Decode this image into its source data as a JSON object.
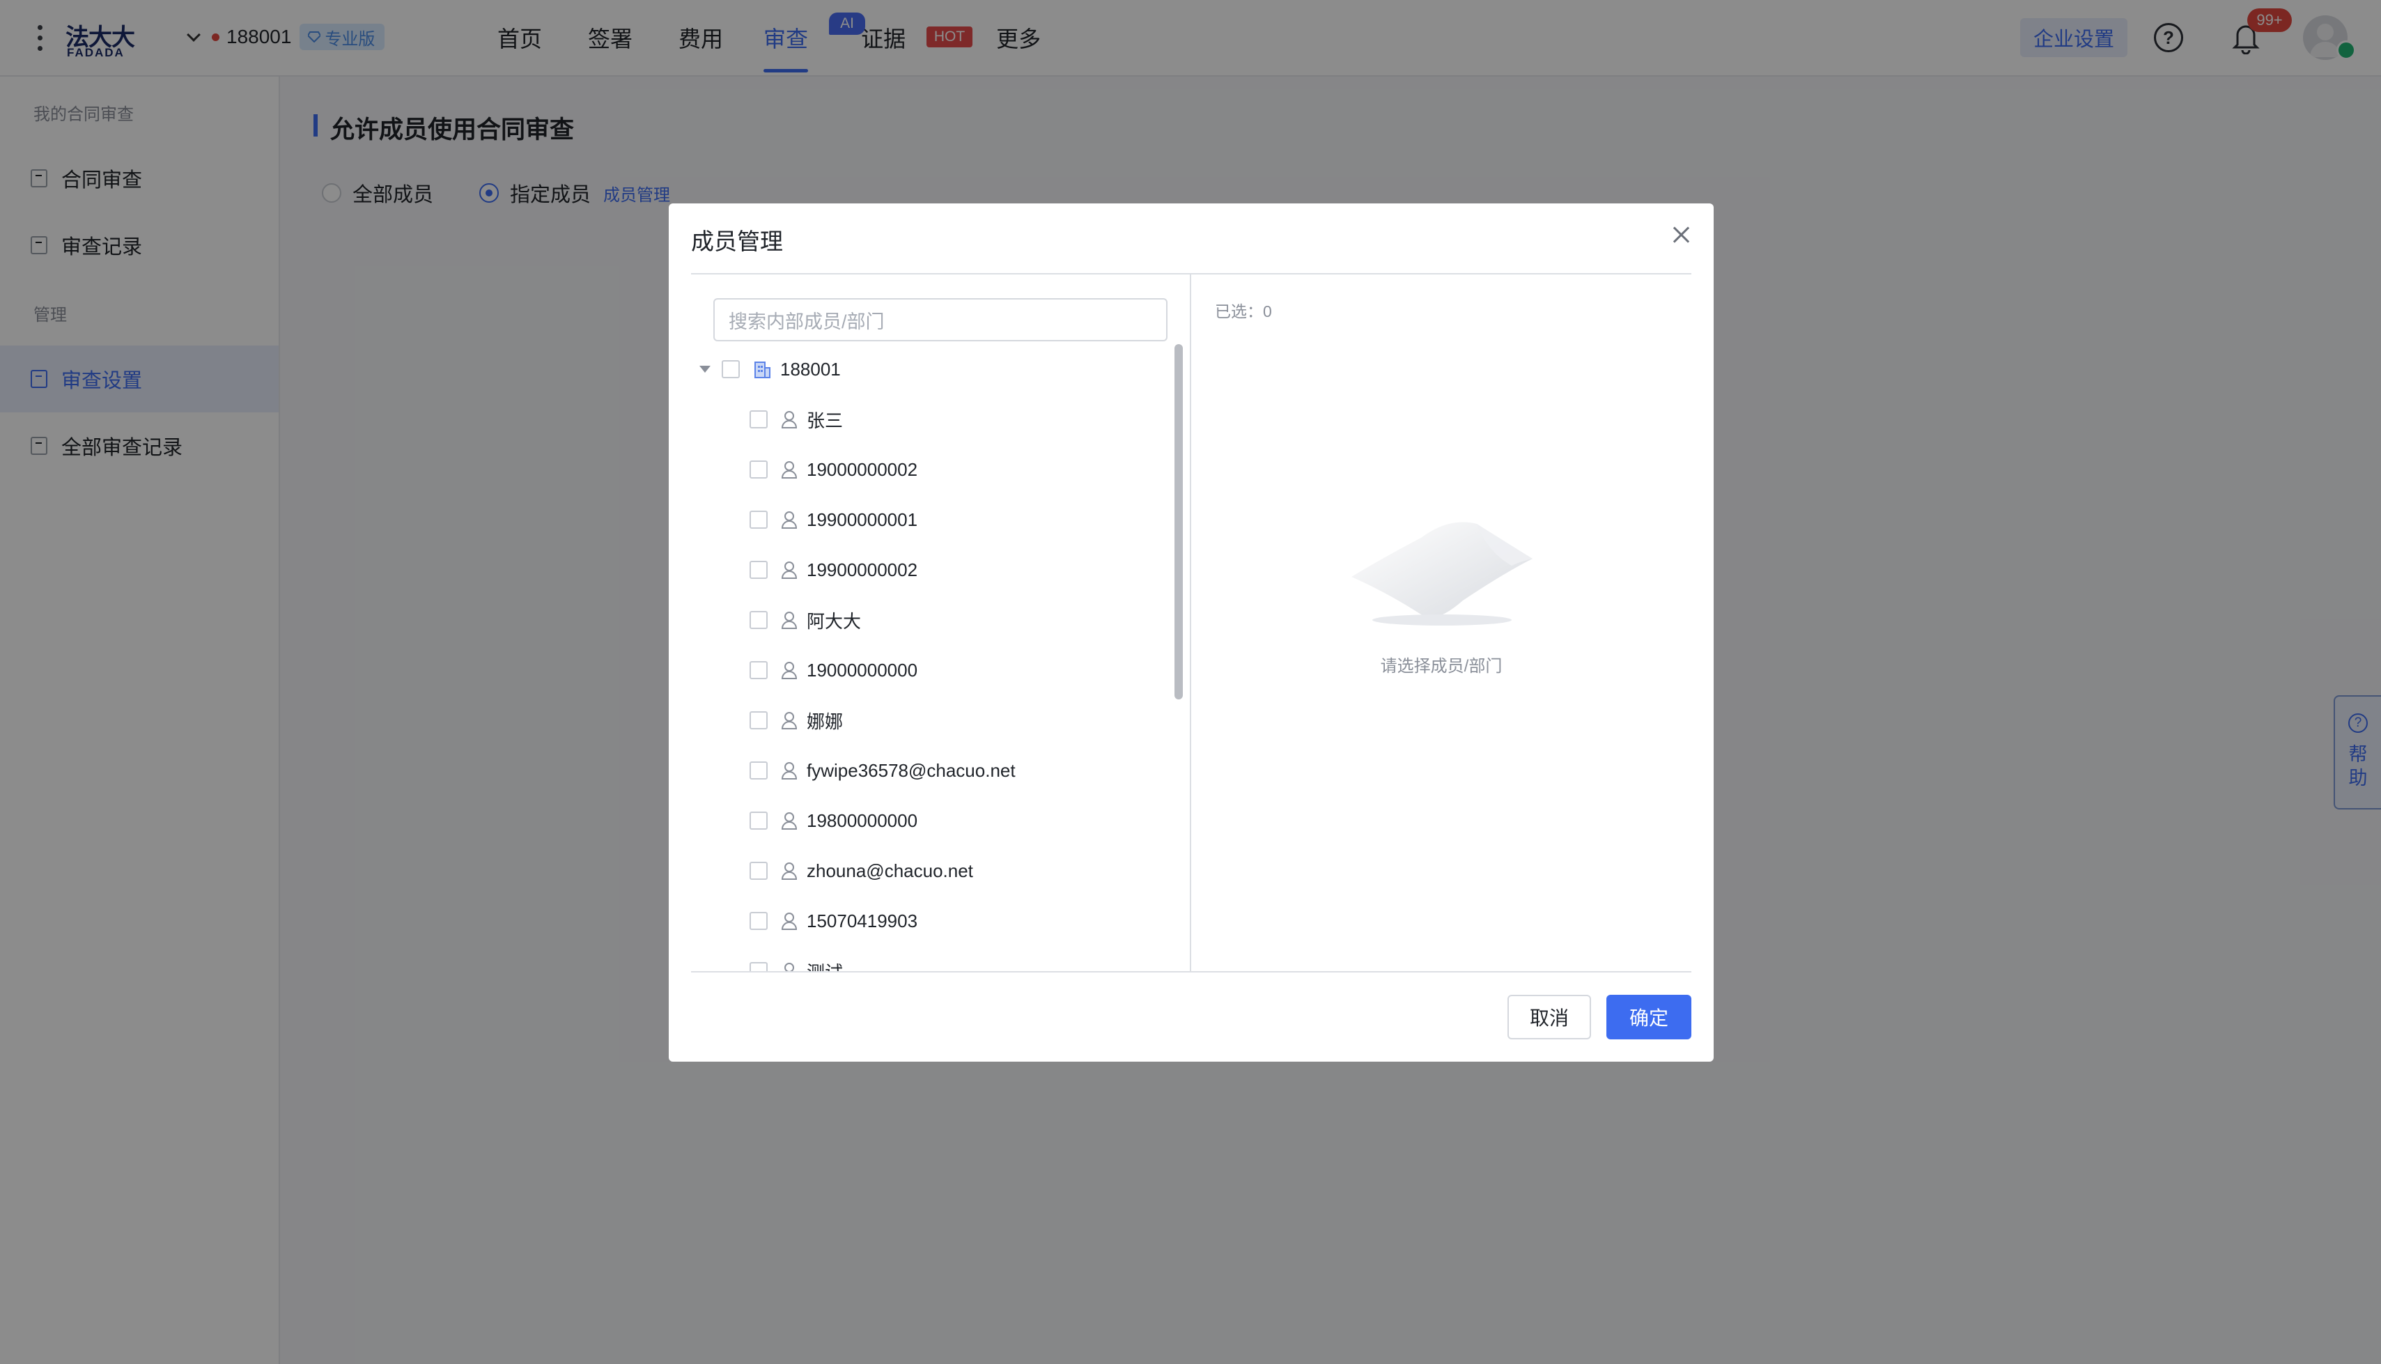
{
  "app": {
    "logo_cn": "法大大",
    "logo_en": "FADADA",
    "org_name": "188001",
    "edition": "专业版"
  },
  "nav": {
    "items": [
      "首页",
      "签署",
      "费用",
      "审查",
      "证据",
      "更多"
    ],
    "active": "审查",
    "ai_tag": "AI",
    "hot_tag": "HOT"
  },
  "header_right": {
    "enterprise_settings": "企业设置",
    "notification_count": "99+"
  },
  "sidebar": {
    "group1": "我的合同审查",
    "group1_items": [
      "合同审查",
      "审查记录"
    ],
    "group2": "管理",
    "group2_items": [
      "审查设置",
      "全部审查记录"
    ],
    "active": "审查设置"
  },
  "main": {
    "title": "允许成员使用合同审查",
    "option_all": "全部成员",
    "option_specified": "指定成员",
    "selected_option": "指定成员",
    "member_link": "成员管理"
  },
  "dialog": {
    "title": "成员管理",
    "search_placeholder": "搜索内部成员/部门",
    "root": "188001",
    "members": [
      "张三",
      "19000000002",
      "19900000001",
      "19900000002",
      "阿大大",
      "19000000000",
      "娜娜",
      "fywipe36578@chacuo.net",
      "19800000000",
      "zhouna@chacuo.net",
      "15070419903",
      "测试"
    ],
    "selected_label": "已选：0",
    "empty_text": "请选择成员/部门",
    "cancel": "取消",
    "confirm": "确定"
  },
  "help_float": {
    "label_1": "帮",
    "label_2": "助"
  },
  "colors": {
    "accent": "#3d6cf0",
    "danger": "#e2483f"
  }
}
